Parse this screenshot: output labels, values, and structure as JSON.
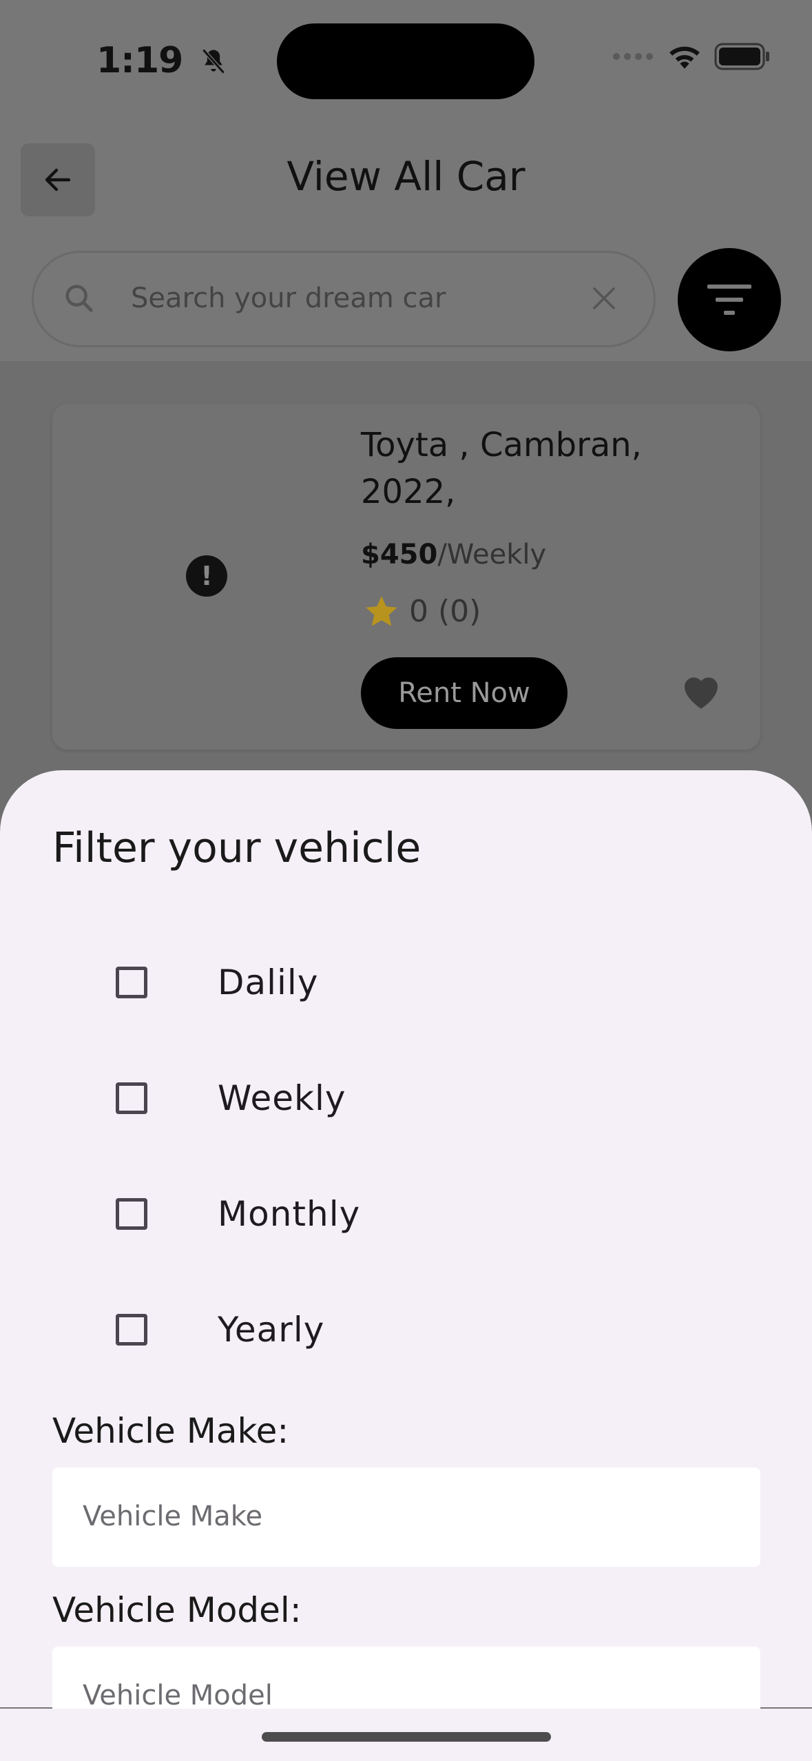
{
  "status_bar": {
    "time": "1:19"
  },
  "header": {
    "title": "View All Car"
  },
  "search": {
    "placeholder": "Search your dream car"
  },
  "car": {
    "title": "Toyta , Cambran, 2022,",
    "price": "$450",
    "period": "/Weekly",
    "rating": "0 (0)",
    "rent_label": "Rent Now"
  },
  "filter": {
    "title": "Filter your vehicle",
    "options": [
      "Dalily",
      "Weekly",
      "Monthly",
      "Yearly"
    ],
    "make_label": "Vehicle Make:",
    "make_placeholder": "Vehicle Make",
    "model_label": "Vehicle Model:",
    "model_placeholder": "Vehicle Model"
  },
  "colors": {
    "star": "#c9a227",
    "primary": "#000000",
    "sheet_bg": "#f5f0f7"
  }
}
